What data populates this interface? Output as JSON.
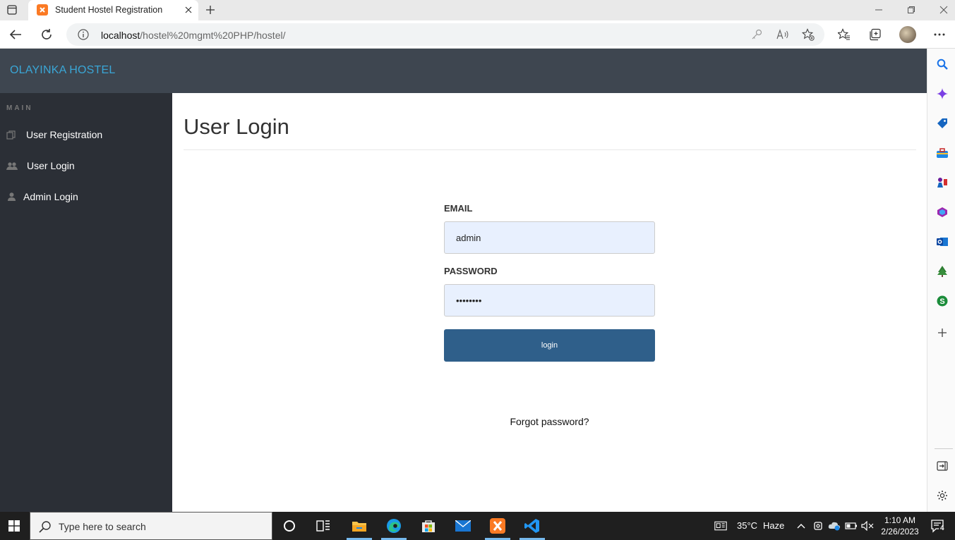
{
  "browser": {
    "tab_title": "Student Hostel Registration",
    "url_host": "localhost",
    "url_path": "/hostel%20mgmt%20PHP/hostel/"
  },
  "site": {
    "brand": "OLAYINKA HOSTEL",
    "sidebar": {
      "heading": "MAIN",
      "items": [
        {
          "label": "User Registration",
          "icon": "files-icon"
        },
        {
          "label": "User Login",
          "icon": "users-icon"
        },
        {
          "label": "Admin Login",
          "icon": "user-icon"
        }
      ]
    },
    "page_title": "User Login",
    "form": {
      "email_label": "EMAIL",
      "email_value": "admin",
      "password_label": "PASSWORD",
      "password_value": "••••••••",
      "login_button": "login",
      "forgot_link": "Forgot password?"
    }
  },
  "taskbar": {
    "search_placeholder": "Type here to search",
    "weather_temp": "35°C",
    "weather_desc": "Haze",
    "time": "1:10 AM",
    "date": "2/26/2023",
    "notification_count": "4"
  },
  "colors": {
    "header_bg": "#3e4650",
    "sidebar_bg": "#2b2f36",
    "brand": "#3aa6d6",
    "button": "#2f5f8a",
    "input_bg": "#e8f0fe"
  }
}
